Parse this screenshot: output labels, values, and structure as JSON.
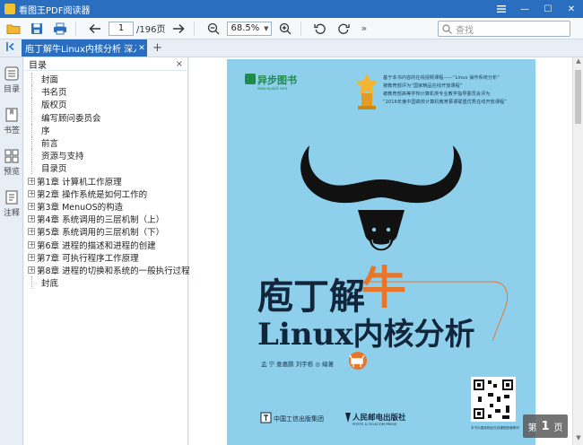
{
  "app": {
    "title": "看图王PDF阅读器"
  },
  "window": {
    "minimize": "—",
    "maximize": "☐",
    "close": "✕"
  },
  "toolbar": {
    "current_page": "1",
    "total_pages": "/196页",
    "zoom": "68.5%",
    "more": "»",
    "search_placeholder": "查找"
  },
  "tabs": [
    {
      "label": "庖丁解牛Linux内核分析 深入理"
    }
  ],
  "leftbar": {
    "items": [
      {
        "label": "目录"
      },
      {
        "label": "书签"
      },
      {
        "label": "预览"
      },
      {
        "label": "注释"
      }
    ]
  },
  "toc": {
    "title": "目录",
    "close": "×",
    "items": [
      {
        "label": "封面",
        "expandable": false
      },
      {
        "label": "书名页",
        "expandable": false
      },
      {
        "label": "版权页",
        "expandable": false
      },
      {
        "label": "编写顾问委员会",
        "expandable": false
      },
      {
        "label": "序",
        "expandable": false
      },
      {
        "label": "前言",
        "expandable": false
      },
      {
        "label": "资源与支持",
        "expandable": false
      },
      {
        "label": "目录页",
        "expandable": false
      },
      {
        "label": "第1章 计算机工作原理",
        "expandable": true
      },
      {
        "label": "第2章 操作系统是如何工作的",
        "expandable": true
      },
      {
        "label": "第3章 MenuOS的构造",
        "expandable": true
      },
      {
        "label": "第4章 系统调用的三层机制（上）",
        "expandable": true
      },
      {
        "label": "第5章 系统调用的三层机制（下）",
        "expandable": true
      },
      {
        "label": "第6章 进程的描述和进程的创建",
        "expandable": true
      },
      {
        "label": "第7章 可执行程序工作原理",
        "expandable": true
      },
      {
        "label": "第8章 进程的切换和系统的一般执行过程",
        "expandable": true
      },
      {
        "label": "封底",
        "expandable": false
      }
    ]
  },
  "cover": {
    "publisher_logo": "异步图书",
    "publisher_url": "www.epubit.com",
    "award_lines": [
      "基于本书内容的在线视频课程——“Linux 操作系统分析”",
      "被教育部评为“国家精品在线开放课程”",
      "被教育部高等学校计算机类专业教学指导委员会评为",
      "“2016年度中国高校计算机教育慕课联盟优秀在线开放课程”"
    ],
    "title_line1": "庖丁解",
    "title_niu": "牛",
    "title_line2": "Linux内核分析",
    "authors": "孟  宁    娄嘉鹏    刘宇栋 ◎ 编著",
    "publisher_left": "中国工信出版集团",
    "publisher_right": "人民邮电出版社",
    "publisher_right_en": "POSTS & TELECOM PRESS",
    "qr_caption": "本书为国家精品在线课程配套教材"
  },
  "page_indicator": {
    "prefix": "第",
    "number": "1",
    "suffix": "页"
  },
  "colors": {
    "accent": "#2a6ebf",
    "cover_bg": "#8ed0ec",
    "title_niu": "#e8762a"
  }
}
